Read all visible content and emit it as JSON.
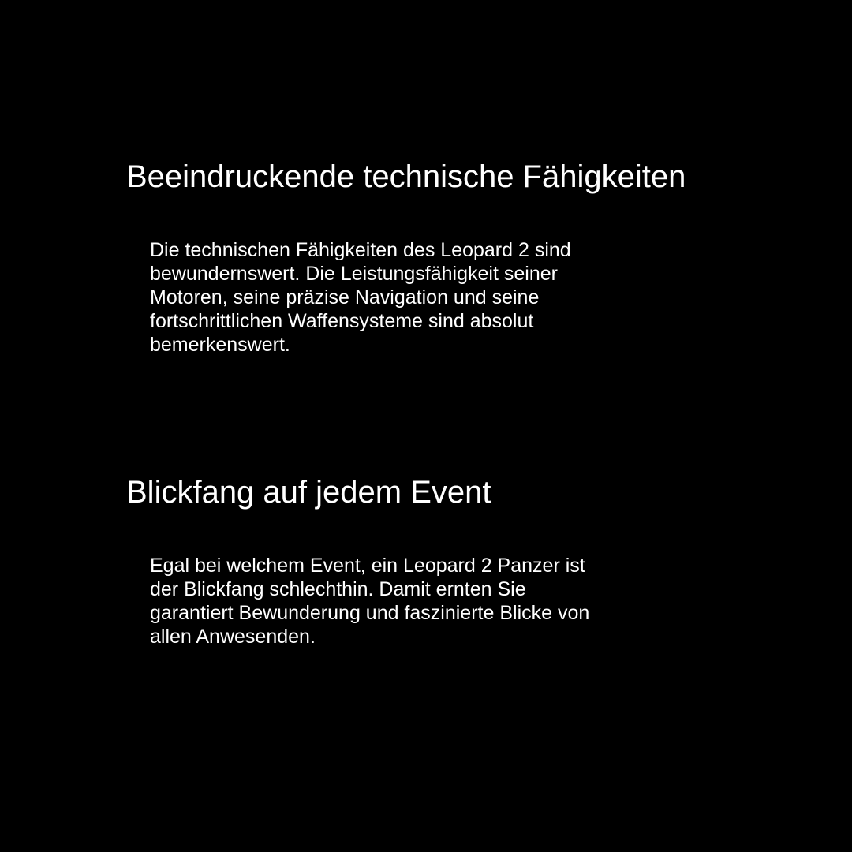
{
  "sections": [
    {
      "heading": "Beeindruckende technische Fähigkeiten",
      "paragraph_lines": [
        "Die technischen Fähigkeiten des Leopard 2 sind",
        "bewundernswert. Die Leistungsfähigkeit seiner",
        "Motoren, seine präzise Navigation und seine",
        "fortschrittlichen Waffensysteme sind absolut",
        "bemerkenswert."
      ]
    },
    {
      "heading": "Blickfang auf jedem Event",
      "paragraph_lines": [
        "Egal bei welchem Event, ein Leopard 2 Panzer ist",
        "der Blickfang schlechthin. Damit ernten Sie",
        "garantiert Bewunderung und faszinierte Blicke von",
        "allen Anwesenden."
      ]
    }
  ],
  "colors": {
    "background": "#000000",
    "text": "#ffffff"
  }
}
